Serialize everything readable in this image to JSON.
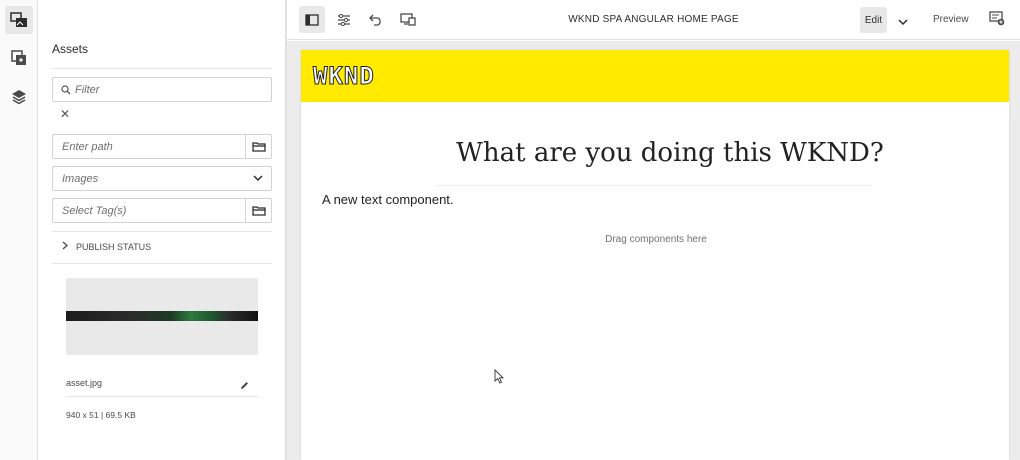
{
  "rail": {
    "items": [
      {
        "icon": "assets-icon",
        "active": true
      },
      {
        "icon": "components-icon",
        "active": false
      },
      {
        "icon": "layers-icon",
        "active": false
      }
    ]
  },
  "side_panel": {
    "title": "Assets",
    "filter": {
      "placeholder": "Filter"
    },
    "clear_label": "✕",
    "path": {
      "placeholder": "Enter path"
    },
    "type_select": {
      "value": "Images"
    },
    "tags": {
      "placeholder": "Select Tag(s)"
    },
    "publish_status_label": "PUBLISH STATUS",
    "asset": {
      "name": "asset.jpg",
      "meta": "940 x 51 | 69.5 KB"
    }
  },
  "toolbar": {
    "page_title": "WKND SPA ANGULAR HOME PAGE",
    "edit_label": "Edit",
    "preview_label": "Preview"
  },
  "page": {
    "logo_text": "WKND",
    "headline": "What are you doing this WKND?",
    "text_component": "A new text component.",
    "drop_zone": "Drag components here"
  },
  "colors": {
    "header_band": "#ffea00",
    "active_bg": "#e8e8e8",
    "canvas_bg": "#ececec"
  }
}
